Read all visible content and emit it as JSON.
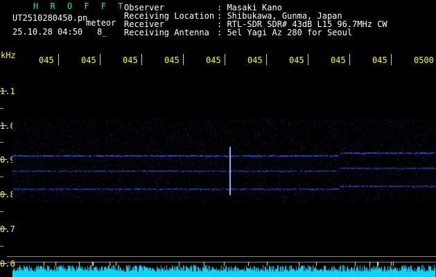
{
  "header": {
    "station_code": "H R O F F T",
    "file_name": "UT2510280450.pn",
    "meteor_label": "meteor",
    "datetime": "25.10.28 04:50",
    "count": "8_"
  },
  "info": {
    "labels": [
      "Observer",
      "Receiving Location",
      "Receiver",
      "Receiving Antenna"
    ],
    "values": [
      ": Masaki Kano",
      ": Shibukawa, Gunma, Japan",
      ": RTL-SDR SDR# 43dB L15 96.7MHz CW",
      ": 5el Yagi Az 280 for Seoul"
    ]
  },
  "axis": {
    "unit": "kHz",
    "time_labels": [
      "045",
      "045",
      "045",
      "045",
      "045",
      "045",
      "045",
      "045",
      "045",
      "0500"
    ],
    "freq_labels": [
      "1.1",
      "1.0",
      "0.9",
      "0.8",
      "0.7",
      "0.6"
    ]
  },
  "colors": {
    "background": "#000000",
    "title_green": "#00ff66",
    "label_yellow": "#ffff00",
    "signal_blue": "#3355ff",
    "spectrum_cyan": "#00e5ff"
  }
}
